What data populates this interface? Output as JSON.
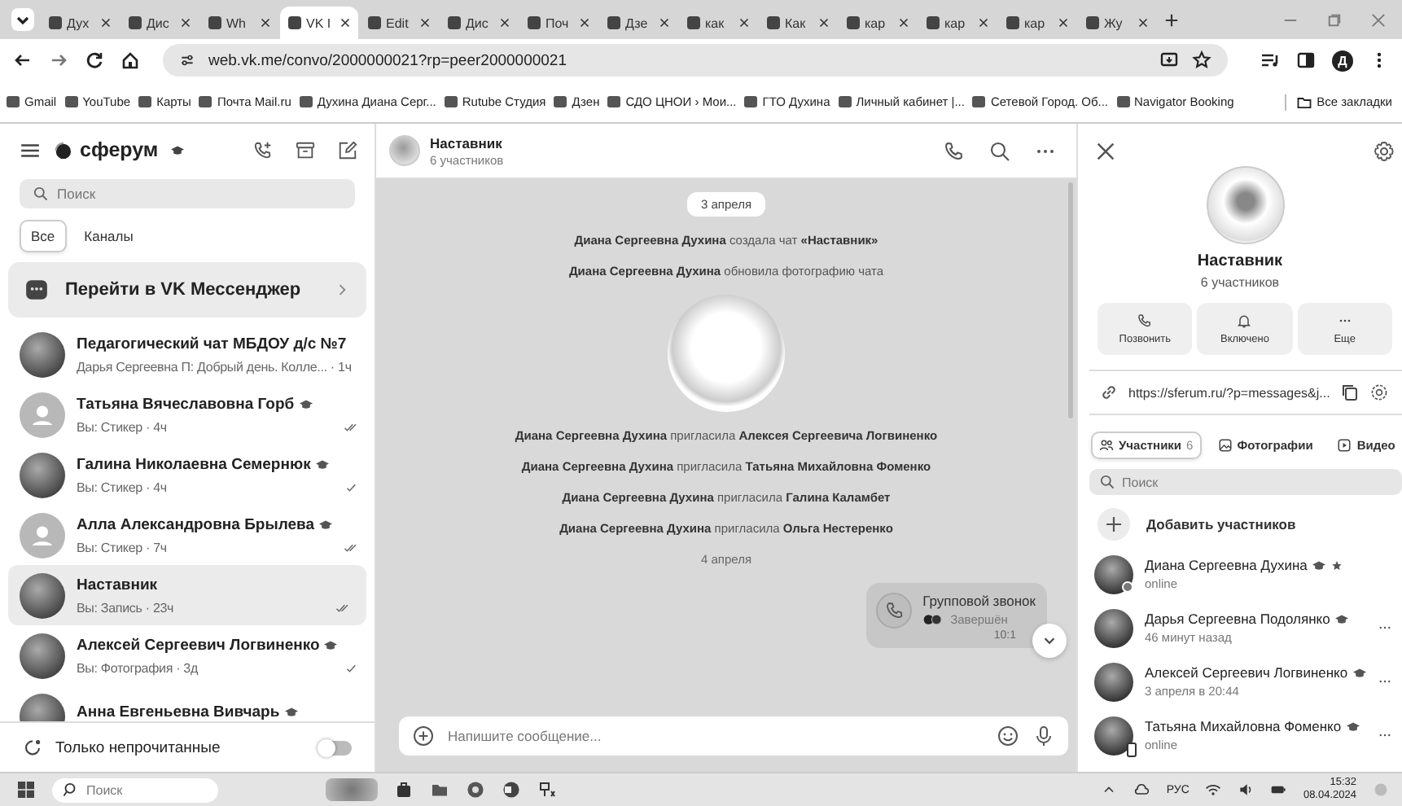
{
  "browser": {
    "tabs": [
      {
        "label": "Дух",
        "selected": false
      },
      {
        "label": "Дис",
        "selected": false
      },
      {
        "label": "Wh",
        "selected": false
      },
      {
        "label": "VK I",
        "selected": true
      },
      {
        "label": "Edit",
        "selected": false
      },
      {
        "label": "Дис",
        "selected": false
      },
      {
        "label": "Поч",
        "selected": false
      },
      {
        "label": "Дзе",
        "selected": false
      },
      {
        "label": "как",
        "selected": false
      },
      {
        "label": "Как",
        "selected": false
      },
      {
        "label": "кар",
        "selected": false
      },
      {
        "label": "кар",
        "selected": false
      },
      {
        "label": "кар",
        "selected": false
      },
      {
        "label": "Жу",
        "selected": false
      }
    ],
    "address": "web.vk.me/convo/2000000021?rp=peer2000000021",
    "profile": "Д",
    "bookmarks": [
      "Gmail",
      "YouTube",
      "Карты",
      "Почта Mail.ru",
      "Духина Диана Серг...",
      "Rutube Студия",
      "Дзен",
      "СДО ЦНОИ › Мои...",
      "ГТО Духина",
      "Личный кабинет |...",
      "Сетевой Город. Об...",
      "Navigator Booking"
    ],
    "all_bookmarks": "Все закладки"
  },
  "sidebar": {
    "brand": "сферум",
    "search": {
      "placeholder": "Поиск"
    },
    "filters": [
      {
        "label": "Все",
        "selected": true
      },
      {
        "label": "Каналы",
        "selected": false
      }
    ],
    "banner": "Перейти в VK Мессенджер",
    "chats": [
      {
        "name": "Педагогический чат МБДОУ д/с №7",
        "preview": "Дарья Сергеевна П: Добрый день. Колле... · 1ч",
        "photo": true,
        "badge": false,
        "selected": false
      },
      {
        "name": "Татьяна Вячеславовна Горб",
        "preview": "Вы: Стикер · 4ч",
        "photo": false,
        "badge": true,
        "sent": true,
        "read": true,
        "selected": false
      },
      {
        "name": "Галина Николаевна Семернюк",
        "preview": "Вы: Стикер · 4ч",
        "photo": true,
        "badge": true,
        "sent": true,
        "read": false,
        "selected": false
      },
      {
        "name": "Алла Александровна Брылева",
        "preview": "Вы: Стикер · 7ч",
        "photo": false,
        "badge": true,
        "sent": true,
        "read": true,
        "selected": false
      },
      {
        "name": "Наставник",
        "preview": "Вы: Запись · 23ч",
        "photo": true,
        "badge": false,
        "sent": true,
        "read": true,
        "selected": true
      },
      {
        "name": "Алексей Сергеевич Логвиненко",
        "preview": "Вы: Фотография · 3д",
        "photo": true,
        "badge": true,
        "sent": true,
        "read": false,
        "selected": false
      },
      {
        "name": "Анна Евгеньевна Вивчарь",
        "photo": true,
        "badge": true,
        "selected": false
      }
    ],
    "unread_only": {
      "label": "Только непрочитанные",
      "on": false
    }
  },
  "chat": {
    "title": "Наставник",
    "subtitle": "6 участников",
    "messages": [
      {
        "kind": "date_pill",
        "text": "3 апреля"
      },
      {
        "kind": "service",
        "text": "**Диана Сергеевна Духина** создала чат **«Наставник»**"
      },
      {
        "kind": "service",
        "text": "**Диана Сергеевна Духина** обновила фотографию чата"
      },
      {
        "kind": "photo"
      },
      {
        "kind": "service",
        "text": "**Диана Сергеевна Духина** пригласила **Алексея Сергеевича Логвиненко**"
      },
      {
        "kind": "service",
        "text": "**Диана Сергеевна Духина** пригласила **Татьяна Михайловна Фоменко**"
      },
      {
        "kind": "service",
        "text": "**Диана Сергеевна Духина** пригласила **Галина Каламбет**"
      },
      {
        "kind": "service",
        "text": "**Диана Сергеевна Духина** пригласила **Ольга Нестеренко**"
      },
      {
        "kind": "date",
        "text": "4 апреля"
      },
      {
        "kind": "call",
        "title": "Групповой звонок",
        "status": "Завершён",
        "time": "10:1"
      }
    ],
    "input": {
      "placeholder": "Напишите сообщение..."
    }
  },
  "details": {
    "title": "Наставник",
    "subtitle": "6 участников",
    "actions": [
      {
        "kind": "call",
        "label": "Позвонить"
      },
      {
        "kind": "notify",
        "label": "Включено"
      },
      {
        "kind": "more",
        "label": "Еще"
      }
    ],
    "link": "https://sferum.ru/?p=messages&j...",
    "tabs": [
      {
        "kind": "members",
        "label": "Участники",
        "count": "6",
        "selected": true
      },
      {
        "kind": "photos",
        "label": "Фотографии",
        "selected": false
      },
      {
        "kind": "videos",
        "label": "Видео",
        "selected": false
      }
    ],
    "search": {
      "placeholder": "Поиск"
    },
    "add": "Добавить участников",
    "members": [
      {
        "name": "Диана Сергеевна Духина",
        "status": "online",
        "online": true,
        "mobile": false,
        "owner": true,
        "menu": false
      },
      {
        "name": "Дарья Сергеевна Подолянко",
        "status": "46 минут назад",
        "online": false,
        "mobile": false,
        "owner": false,
        "menu": true
      },
      {
        "name": "Алексей Сергеевич Логвиненко",
        "status": "3 апреля в 20:44",
        "online": false,
        "mobile": false,
        "owner": false,
        "menu": true
      },
      {
        "name": "Татьяна Михайловна Фоменко",
        "status": "online",
        "online": false,
        "mobile": true,
        "owner": false,
        "menu": true
      }
    ]
  },
  "taskbar": {
    "search": {
      "placeholder": "Поиск"
    },
    "language": "РУС",
    "time": "15:32",
    "date": "08.04.2024"
  }
}
